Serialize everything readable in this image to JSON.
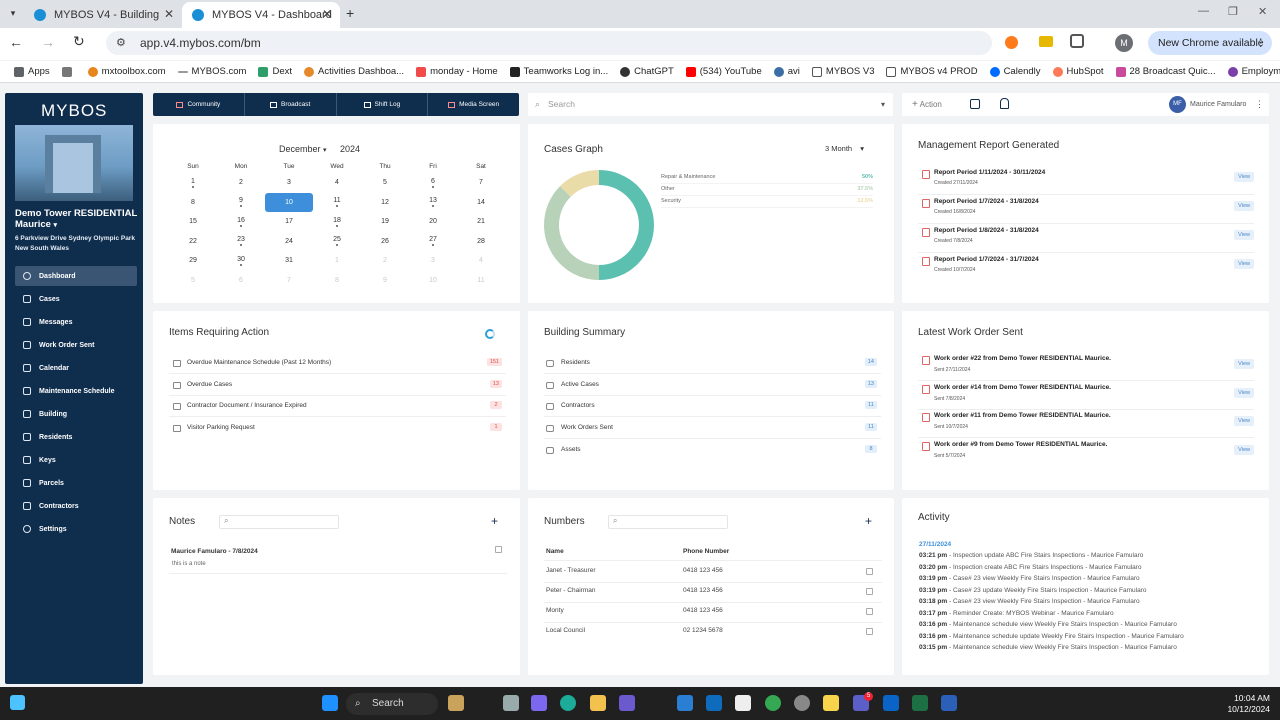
{
  "browser": {
    "tabs": [
      {
        "label": "MYBOS V4 - Building"
      },
      {
        "label": "MYBOS V4 - Dashboard"
      }
    ],
    "url": "app.v4.mybos.com/bm",
    "new_chrome": "New Chrome available",
    "profile_initial": "M",
    "bookmarks": [
      "Apps",
      "mxtoolbox.com",
      "MYBOS.com",
      "Dext",
      "Activities Dashboa...",
      "monday - Home",
      "Teamworks Log in...",
      "ChatGPT",
      "(534) YouTube",
      "avi",
      "MYBOS V3",
      "MYBOS v4 PROD",
      "Calendly",
      "HubSpot",
      "28 Broadcast Quic...",
      "Employment Hero"
    ]
  },
  "sidebar": {
    "logo": "MYBOS",
    "property_name": "Demo Tower RESIDENTIAL Maurice",
    "property_address": "6 Parkview Drive Sydney Olympic Park New South Wales",
    "items": [
      {
        "label": "Dashboard",
        "icon": "dashboard-icon"
      },
      {
        "label": "Cases",
        "icon": "cases-icon"
      },
      {
        "label": "Messages",
        "icon": "messages-icon"
      },
      {
        "label": "Work Order Sent",
        "icon": "work-order-icon"
      },
      {
        "label": "Calendar",
        "icon": "calendar-icon"
      },
      {
        "label": "Maintenance Schedule",
        "icon": "maintenance-icon"
      },
      {
        "label": "Building",
        "icon": "building-icon"
      },
      {
        "label": "Residents",
        "icon": "residents-icon"
      },
      {
        "label": "Keys",
        "icon": "keys-icon"
      },
      {
        "label": "Parcels",
        "icon": "parcels-icon"
      },
      {
        "label": "Contractors",
        "icon": "contractors-icon"
      },
      {
        "label": "Settings",
        "icon": "settings-icon"
      }
    ]
  },
  "topnav": {
    "items": [
      "Community",
      "Broadcast",
      "Shift Log",
      "Media Screen"
    ],
    "search_placeholder": "Search",
    "action": "Action",
    "user_initials": "MF",
    "user_name": "Maurice Famularo"
  },
  "calendar": {
    "month": "December",
    "year": "2024",
    "days": [
      "Sun",
      "Mon",
      "Tue",
      "Wed",
      "Thu",
      "Fri",
      "Sat"
    ],
    "weeks": [
      [
        "1",
        "2",
        "3",
        "4",
        "5",
        "6",
        "7"
      ],
      [
        "8",
        "9",
        "10",
        "11",
        "12",
        "13",
        "14"
      ],
      [
        "15",
        "16",
        "17",
        "18",
        "19",
        "20",
        "21"
      ],
      [
        "22",
        "23",
        "24",
        "25",
        "26",
        "27",
        "28"
      ],
      [
        "29",
        "30",
        "31",
        "1",
        "2",
        "3",
        "4"
      ],
      [
        "5",
        "6",
        "7",
        "8",
        "9",
        "10",
        "11"
      ]
    ]
  },
  "cases_graph": {
    "title": "Cases Graph",
    "period": "3 Month",
    "legend": [
      {
        "label": "Repair & Maintenance",
        "value": "50%",
        "color": "#5cc0b0"
      },
      {
        "label": "Other",
        "value": "37.5%",
        "color": "#b7d2b8"
      },
      {
        "label": "Security",
        "value": "12.5%",
        "color": "#e9dca9"
      }
    ]
  },
  "chart_data": {
    "type": "pie",
    "title": "Cases Graph",
    "categories": [
      "Repair & Maintenance",
      "Other",
      "Security"
    ],
    "values": [
      50,
      37.5,
      12.5
    ]
  },
  "mgmt_reports": {
    "title": "Management Report Generated",
    "view": "View",
    "items": [
      {
        "title": "Report Period 1/11/2024 - 30/11/2024",
        "created": "Created 27/11/2024"
      },
      {
        "title": "Report Period 1/7/2024 - 31/8/2024",
        "created": "Created 16/8/2024"
      },
      {
        "title": "Report Period 1/8/2024 - 31/8/2024",
        "created": "Created 7/8/2024"
      },
      {
        "title": "Report Period 1/7/2024 - 31/7/2024",
        "created": "Created 10/7/2024"
      }
    ]
  },
  "items_action": {
    "title": "Items Requiring Action",
    "items": [
      {
        "label": "Overdue Maintenance Schedule (Past 12 Months)",
        "count": "151"
      },
      {
        "label": "Overdue Cases",
        "count": "13"
      },
      {
        "label": "Contractor Document / Insurance Expired",
        "count": "2"
      },
      {
        "label": "Visitor Parking Request",
        "count": "1"
      }
    ]
  },
  "building_summary": {
    "title": "Building Summary",
    "items": [
      {
        "label": "Residents",
        "count": "14"
      },
      {
        "label": "Active Cases",
        "count": "13"
      },
      {
        "label": "Contractors",
        "count": "11"
      },
      {
        "label": "Work Orders Sent",
        "count": "11"
      },
      {
        "label": "Assets",
        "count": "8"
      }
    ]
  },
  "work_orders": {
    "title": "Latest Work Order Sent",
    "view": "View",
    "items": [
      {
        "title": "Work order #22 from Demo Tower RESIDENTIAL Maurice.",
        "sent": "Sent 27/11/2024"
      },
      {
        "title": "Work order #14 from Demo Tower RESIDENTIAL Maurice.",
        "sent": "Sent 7/8/2024"
      },
      {
        "title": "Work order #11 from Demo Tower RESIDENTIAL Maurice.",
        "sent": "Sent 10/7/2024"
      },
      {
        "title": "Work order #9 from Demo Tower RESIDENTIAL Maurice.",
        "sent": "Sent 5/7/2024"
      }
    ]
  },
  "notes": {
    "title": "Notes",
    "items": [
      {
        "author": "Maurice Famularo - 7/8/2024",
        "text": "this is a note"
      }
    ]
  },
  "numbers": {
    "title": "Numbers",
    "headers": [
      "Name",
      "Phone Number"
    ],
    "rows": [
      {
        "name": "Janet - Treasurer",
        "phone": "0418 123 456"
      },
      {
        "name": "Peter - Chairman",
        "phone": "0418 123 456"
      },
      {
        "name": "Monty",
        "phone": "0418 123 456"
      },
      {
        "name": "Local Council",
        "phone": "02 1234 5678"
      }
    ]
  },
  "activity": {
    "title": "Activity",
    "date": "27/11/2024",
    "items": [
      {
        "time": "03:21 pm",
        "text": " - Inspection update ABC Fire Stairs Inspections - Maurice Famularo"
      },
      {
        "time": "03:20 pm",
        "text": " - Inspection create ABC Fire Stairs Inspections - Maurice Famularo"
      },
      {
        "time": "03:19 pm",
        "text": " - Case# 23 view Weekly Fire Stairs Inspection - Maurice Famularo"
      },
      {
        "time": "03:19 pm",
        "text": " - Case# 23 update Weekly Fire Stairs Inspection - Maurice Famularo"
      },
      {
        "time": "03:18 pm",
        "text": " - Case# 23 view Weekly Fire Stairs Inspection - Maurice Famularo"
      },
      {
        "time": "03:17 pm",
        "text": " - Reminder Create: MYBOS Webinar - Maurice Famularo"
      },
      {
        "time": "03:16 pm",
        "text": " - Maintenance schedule view Weekly Fire Stairs Inspection - Maurice Famularo"
      },
      {
        "time": "03:16 pm",
        "text": " - Maintenance schedule update Weekly Fire Stairs Inspection - Maurice Famularo"
      },
      {
        "time": "03:15 pm",
        "text": " - Maintenance schedule view Weekly Fire Stairs Inspection - Maurice Famularo"
      }
    ]
  },
  "taskbar": {
    "search": "Search",
    "time": "10:04 AM",
    "date": "10/12/2024",
    "teams_badge": "5"
  }
}
